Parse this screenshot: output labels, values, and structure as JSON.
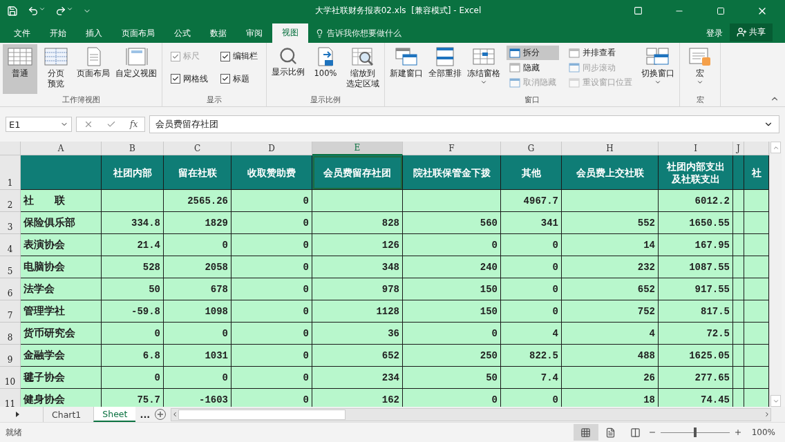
{
  "window": {
    "title": "大学社联财务报表02.xls  [兼容模式] - Excel"
  },
  "menu_tabs": [
    {
      "label": "文件",
      "selected": false
    },
    {
      "label": "开始",
      "selected": false
    },
    {
      "label": "插入",
      "selected": false
    },
    {
      "label": "页面布局",
      "selected": false
    },
    {
      "label": "公式",
      "selected": false
    },
    {
      "label": "数据",
      "selected": false
    },
    {
      "label": "审阅",
      "selected": false
    },
    {
      "label": "视图",
      "selected": true
    }
  ],
  "tell_me": "告诉我你想要做什么",
  "sign_in": "登录",
  "share": "共享",
  "ribbon": [
    {
      "label": "工作簿视图",
      "items": [
        {
          "kind": "large",
          "label": "普通",
          "selected": true
        },
        {
          "kind": "large",
          "label_lines": [
            "分页",
            "预览"
          ],
          "selected": false
        },
        {
          "kind": "large",
          "label": "页面布局",
          "selected": false
        },
        {
          "kind": "large",
          "label": "自定义视图",
          "selected": false
        }
      ]
    },
    {
      "label": "显示",
      "items": [
        {
          "kind": "stack",
          "entries": [
            {
              "kind": "check",
              "label": "标尺",
              "checked": true,
              "disabled": true
            },
            {
              "kind": "check",
              "label": "网格线",
              "checked": true,
              "disabled": false
            }
          ]
        },
        {
          "kind": "stack",
          "entries": [
            {
              "kind": "check",
              "label": "编辑栏",
              "checked": true,
              "disabled": false
            },
            {
              "kind": "check",
              "label": "标题",
              "checked": true,
              "disabled": false
            }
          ]
        }
      ]
    },
    {
      "label": "显示比例",
      "items": [
        {
          "kind": "large",
          "label": "显示比例",
          "selected": false
        },
        {
          "kind": "large",
          "label": "100%",
          "selected": false
        },
        {
          "kind": "large",
          "label_lines": [
            "缩放到",
            "选定区域"
          ],
          "selected": false
        }
      ]
    },
    {
      "label": "窗口",
      "items": [
        {
          "kind": "large",
          "label": "新建窗口",
          "selected": false
        },
        {
          "kind": "large",
          "label": "全部重排",
          "selected": false
        },
        {
          "kind": "large",
          "label": "冻结窗格",
          "selected": false,
          "menu": true
        },
        {
          "kind": "stack",
          "entries": [
            {
              "kind": "small",
              "label": "拆分",
              "selected": true,
              "disabled": false
            },
            {
              "kind": "small",
              "label": "隐藏",
              "selected": false,
              "disabled": false
            },
            {
              "kind": "small",
              "label": "取消隐藏",
              "selected": false,
              "disabled": true
            }
          ]
        },
        {
          "kind": "stack",
          "entries": [
            {
              "kind": "small",
              "label": "并排查看",
              "selected": false,
              "disabled": false
            },
            {
              "kind": "small",
              "label": "同步滚动",
              "selected": false,
              "disabled": true
            },
            {
              "kind": "small",
              "label": "重设窗口位置",
              "selected": false,
              "disabled": true
            }
          ]
        },
        {
          "kind": "large",
          "label": "切换窗口",
          "selected": false,
          "menu": true
        }
      ]
    },
    {
      "label": "宏",
      "items": [
        {
          "kind": "large",
          "label": "宏",
          "selected": false,
          "menu": true
        }
      ]
    }
  ],
  "formula_bar": {
    "name_box": "E1",
    "function_label": "fx",
    "formula": "会员费留存社团"
  },
  "sheet": {
    "columns": [
      {
        "letter": "A",
        "selected": false
      },
      {
        "letter": "B",
        "selected": false
      },
      {
        "letter": "C",
        "selected": false
      },
      {
        "letter": "D",
        "selected": false
      },
      {
        "letter": "E",
        "selected": true
      },
      {
        "letter": "F",
        "selected": false
      },
      {
        "letter": "G",
        "selected": false
      },
      {
        "letter": "H",
        "selected": false
      },
      {
        "letter": "I",
        "selected": false
      },
      {
        "letter": "J",
        "selected": false
      },
      {
        "selected": false
      }
    ],
    "rows": [
      {
        "number": "1",
        "kind": "header",
        "cells": [
          null,
          "社团内部",
          "留在社联",
          "收取赞助费",
          "会员费留存社团",
          "院社联保管金下拨",
          "其他",
          "会员费上交社联",
          [
            "社团内部支出",
            "及社联支出"
          ],
          null,
          "社"
        ]
      },
      {
        "number": "2",
        "kind": "data",
        "cells": [
          "社　　联",
          null,
          "2565.26",
          "0",
          null,
          null,
          "4967.7",
          null,
          "6012.2",
          null,
          null
        ]
      },
      {
        "number": "3",
        "kind": "data",
        "cells": [
          "保险俱乐部",
          "334.8",
          "1829",
          "0",
          "828",
          "560",
          "341",
          "552",
          "1650.55",
          null,
          null
        ]
      },
      {
        "number": "4",
        "kind": "data",
        "cells": [
          "表演协会",
          "21.4",
          "0",
          "0",
          "126",
          "0",
          "0",
          "14",
          "167.95",
          null,
          null
        ]
      },
      {
        "number": "5",
        "kind": "data",
        "cells": [
          "电脑协会",
          "528",
          "2058",
          "0",
          "348",
          "240",
          "0",
          "232",
          "1087.55",
          null,
          null
        ]
      },
      {
        "number": "6",
        "kind": "data",
        "cells": [
          "法学会",
          "50",
          "678",
          "0",
          "978",
          "150",
          "0",
          "652",
          "917.55",
          null,
          null
        ]
      },
      {
        "number": "7",
        "kind": "data",
        "cells": [
          "管理学社",
          "-59.8",
          "1098",
          "0",
          "1128",
          "150",
          "0",
          "752",
          "817.5",
          null,
          null
        ]
      },
      {
        "number": "8",
        "kind": "data",
        "cells": [
          "货币研究会",
          "0",
          "0",
          "0",
          "36",
          "0",
          "4",
          "4",
          "72.5",
          null,
          null
        ]
      },
      {
        "number": "9",
        "kind": "data",
        "cells": [
          "金融学会",
          "6.8",
          "1031",
          "0",
          "652",
          "250",
          "822.5",
          "488",
          "1625.05",
          null,
          null
        ]
      },
      {
        "number": "10",
        "kind": "data",
        "cells": [
          "毽子协会",
          "0",
          "0",
          "0",
          "234",
          "50",
          "7.4",
          "26",
          "277.65",
          null,
          null
        ]
      },
      {
        "number": "11",
        "kind": "data",
        "cells": [
          "健身协会",
          "75.7",
          "-1603",
          "0",
          "162",
          "0",
          "0",
          "18",
          "74.45",
          null,
          null
        ]
      }
    ]
  },
  "sheet_tabs": [
    {
      "label": "Chart1",
      "selected": false
    },
    {
      "label": "Sheet",
      "selected": true
    }
  ],
  "more_sheets": "...",
  "status_bar": {
    "status": "就绪",
    "views": [
      {
        "selected": true
      },
      {
        "selected": false
      },
      {
        "selected": false
      }
    ],
    "zoom": {
      "level": 0.5
    },
    "zoom_text": "100%"
  }
}
